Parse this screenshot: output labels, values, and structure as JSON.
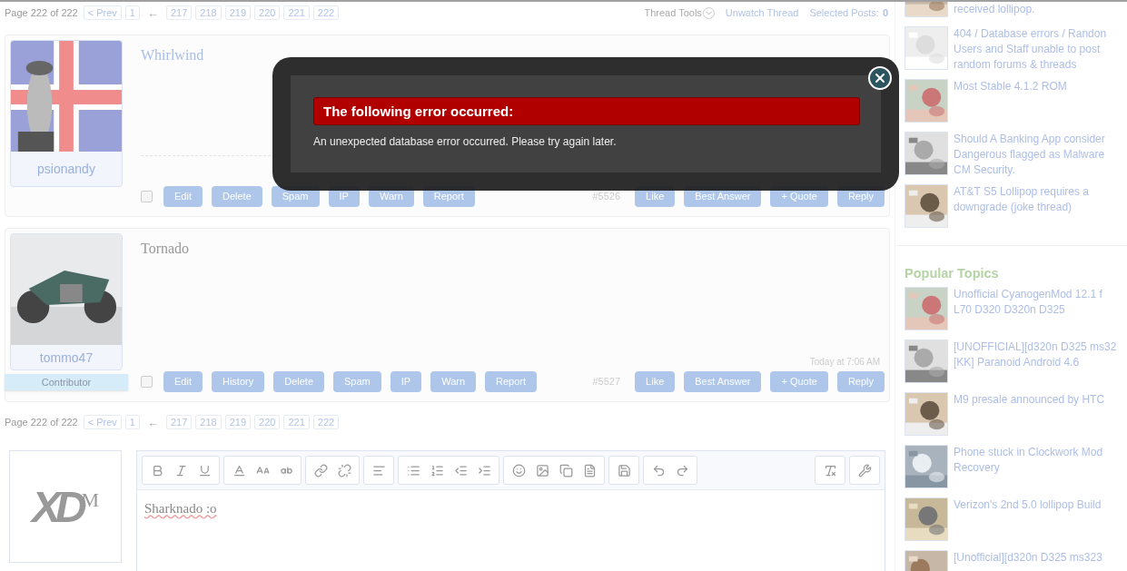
{
  "pagination_top": {
    "label": "Page 222 of 222",
    "prev": "< Prev",
    "first": "1",
    "arrow": "←",
    "pages": [
      "217",
      "218",
      "219",
      "220",
      "221",
      "222"
    ]
  },
  "thread_tools": {
    "tools": "Thread Tools",
    "unwatch": "Unwatch Thread",
    "selected_label": "Selected Posts:",
    "selected_count": "0"
  },
  "posts": [
    {
      "username": "psionandy",
      "title": "Whirlwind",
      "number": "#5526",
      "checked": false,
      "left_buttons": [
        "Edit",
        "Delete",
        "Spam",
        "IP",
        "Warn",
        "Report"
      ],
      "right_buttons": [
        "Like",
        "Best Answer",
        "+ Quote",
        "Reply"
      ]
    },
    {
      "username": "tommo47",
      "role": "Contributor",
      "title": "Tornado",
      "date": "Today at 7:06 AM",
      "number": "#5527",
      "checked": false,
      "left_buttons": [
        "Edit",
        "History",
        "Delete",
        "Spam",
        "IP",
        "Warn",
        "Report"
      ],
      "right_buttons": [
        "Like",
        "Best Answer",
        "+ Quote",
        "Reply"
      ]
    }
  ],
  "pagination_bottom": {
    "label": "Page 222 of 222",
    "prev": "< Prev",
    "first": "1",
    "arrow": "←",
    "pages": [
      "217",
      "218",
      "219",
      "220",
      "221",
      "222"
    ]
  },
  "editor": {
    "logo": "XD",
    "logo_sup": "M",
    "value": "Sharknado :o"
  },
  "modal": {
    "title": "The following error occurred:",
    "message": "An unexpected database error occurred. Please try again later."
  },
  "sidebar": {
    "items": [
      {
        "lines": [
          "received lollipop."
        ]
      },
      {
        "lines": [
          "404 / Database errors / Randon",
          "Users and Staff unable to post",
          "random forums & threads"
        ]
      },
      {
        "lines": [
          "Most Stable 4.1.2 ROM"
        ]
      },
      {
        "lines": [
          "Should A Banking App consider",
          "Dangerous flagged as Malware",
          "CM Security."
        ]
      },
      {
        "lines": [
          "AT&T S5 Lollipop requires a",
          "downgrade (joke thread)"
        ]
      }
    ],
    "popular_heading": "Popular Topics",
    "popular": [
      {
        "lines": [
          "Unofficial CyanogenMod 12.1 f",
          "L70 D320 D320n D325"
        ]
      },
      {
        "lines": [
          "[UNOFFICIAL][d320n D325 ms32",
          "[KK] Paranoid Android 4.6"
        ]
      },
      {
        "lines": [
          "M9 presale announced by HTC"
        ]
      },
      {
        "lines": [
          "Phone stuck in Clockwork Mod",
          "Recovery"
        ]
      },
      {
        "lines": [
          "Verizon's 2nd 5.0 lollipop Build"
        ]
      },
      {
        "lines": [
          "[Unofficial][d320n D325 ms323"
        ]
      }
    ]
  }
}
